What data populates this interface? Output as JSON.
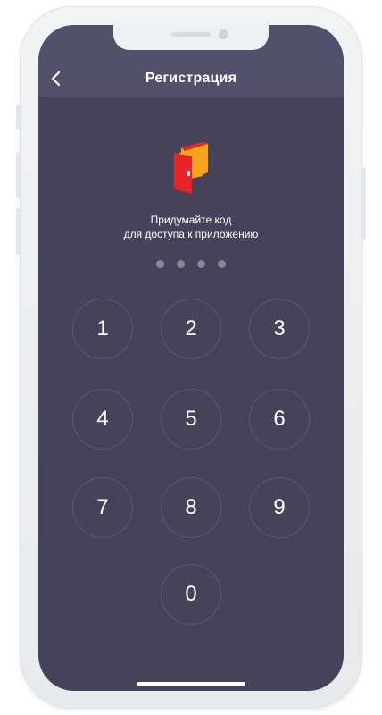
{
  "header": {
    "title": "Регистрация",
    "back_icon": "chevron-left-icon"
  },
  "logo": {
    "icon": "wallet-door-logo",
    "colors": {
      "red": "#e8242b",
      "orange": "#f7a41c"
    }
  },
  "prompt": {
    "line1": "Придумайте код",
    "line2": "для доступа к приложению"
  },
  "pin": {
    "length": 4,
    "entered": 0
  },
  "keypad": {
    "keys": [
      "1",
      "2",
      "3",
      "4",
      "5",
      "6",
      "7",
      "8",
      "9",
      "0"
    ]
  },
  "colors": {
    "screen_bg": "#464259",
    "header_bg": "#52506a",
    "dot": "#898698"
  }
}
